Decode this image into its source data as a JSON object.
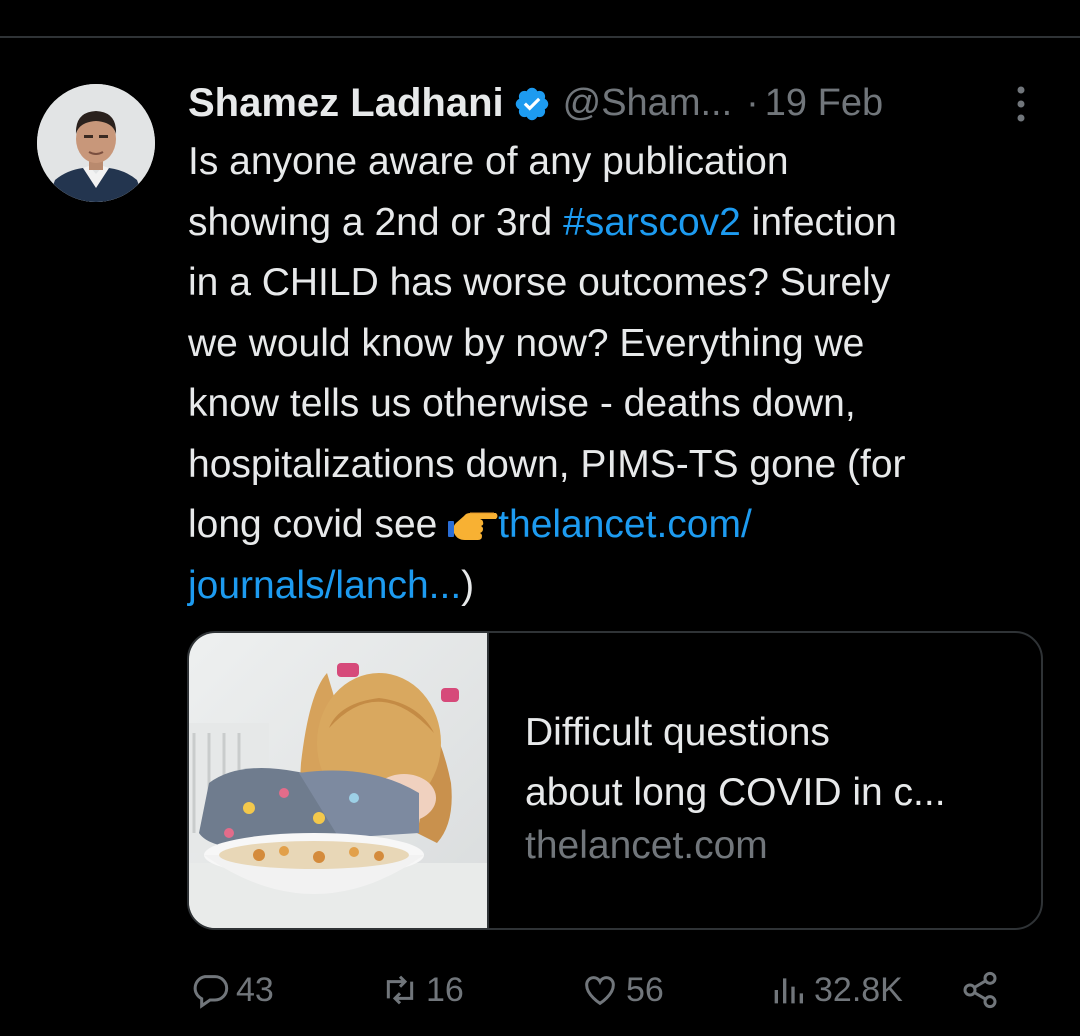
{
  "tweet": {
    "author_name": "Shamez Ladhani",
    "handle": "@Sham...",
    "separator": "·",
    "date": "19 Feb",
    "lines": [
      {
        "pre": "Is anyone aware of any publication"
      },
      {
        "pre": "showing a 2nd or 3rd ",
        "tag": "#sarscov2",
        "post": " infection"
      },
      {
        "pre": "in a CHILD has worse outcomes? Surely"
      },
      {
        "pre": "we would know by now? Everything we"
      },
      {
        "pre": "know tells us otherwise - deaths down,"
      },
      {
        "pre": "hospitalizations down, PIMS-TS gone (for"
      },
      {
        "pre": "long covid see ",
        "link": "thelancet.com/"
      },
      {
        "link": "journals/lanch...",
        "post": ")"
      }
    ]
  },
  "card": {
    "title_line1": "Difficult questions",
    "title_line2": "about long COVID in c...",
    "domain": "thelancet.com"
  },
  "actions": {
    "replies": "43",
    "reposts": "16",
    "likes": "56",
    "views": "32.8K"
  },
  "colors": {
    "background": "#000000",
    "text": "#e7e9ea",
    "muted": "#71767b",
    "accent": "#1d9bf0"
  },
  "icons": [
    "verified-badge-icon",
    "more-icon",
    "pointing-hand-emoji",
    "reply-icon",
    "repost-icon",
    "like-icon",
    "views-icon",
    "share-icon"
  ]
}
